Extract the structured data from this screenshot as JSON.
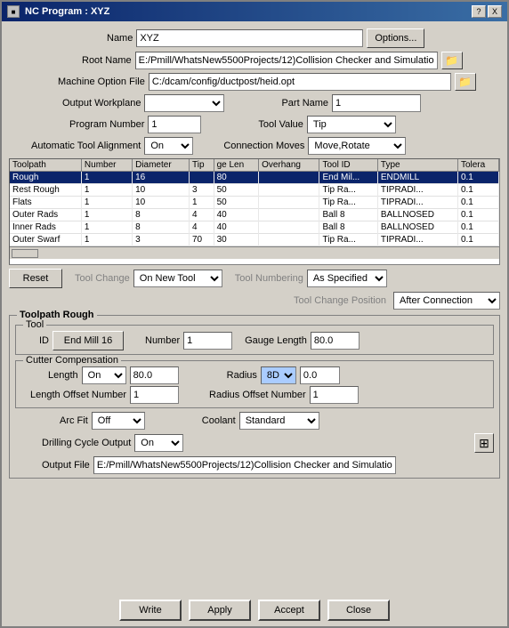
{
  "window": {
    "title": "NC Program : XYZ",
    "help_btn": "?",
    "close_btn": "X"
  },
  "form": {
    "name_label": "Name",
    "name_value": "XYZ",
    "options_btn": "Options...",
    "root_name_label": "Root Name",
    "root_name_value": "E:/Pmill/WhatsNew5500Projects/12)Collision Checker and Simulatio",
    "machine_option_label": "Machine Option File",
    "machine_option_value": "C:/dcam/config/ductpost/heid.opt",
    "output_workplane_label": "Output Workplane",
    "output_workplane_value": "",
    "part_name_label": "Part Name",
    "part_name_value": "1",
    "program_number_label": "Program Number",
    "program_number_value": "1",
    "tool_value_label": "Tool Value",
    "tool_value_value": "Tip",
    "auto_tool_align_label": "Automatic Tool Alignment",
    "auto_tool_align_value": "On",
    "connection_moves_label": "Connection Moves",
    "connection_moves_value": "Move,Rotate",
    "tool_change_label": "Tool Change",
    "tool_change_value": "On New Tool",
    "tool_numbering_label": "Tool Numbering",
    "tool_numbering_value": "As Specified",
    "tool_change_pos_label": "Tool Change Position",
    "tool_change_pos_value": "After Connection",
    "reset_btn": "Reset"
  },
  "table": {
    "columns": [
      "Toolpath",
      "Number",
      "Diameter",
      "Tip",
      "ge Len",
      "Overhang",
      "Tool ID",
      "Type",
      "Tolera"
    ],
    "rows": [
      [
        "Rough",
        "1",
        "16",
        "",
        "80",
        "",
        "End Mil...",
        "ENDMILL",
        "0.1"
      ],
      [
        "Rest Rough",
        "1",
        "10",
        "3",
        "50",
        "",
        "Tip Ra...",
        "TIPRADI...",
        "0.1"
      ],
      [
        "Flats",
        "1",
        "10",
        "1",
        "50",
        "",
        "Tip Ra...",
        "TIPRADI...",
        "0.1"
      ],
      [
        "Outer Rads",
        "1",
        "8",
        "4",
        "40",
        "",
        "Ball 8",
        "BALLNOSED",
        "0.1"
      ],
      [
        "Inner Rads",
        "1",
        "8",
        "4",
        "40",
        "",
        "Ball 8",
        "BALLNOSED",
        "0.1"
      ],
      [
        "Outer Swarf",
        "1",
        "3",
        "70",
        "30",
        "",
        "Tip Ra...",
        "TIPRADI...",
        "0.1"
      ]
    ],
    "selected_row": 0
  },
  "toolpath_section": {
    "label": "Toolpath Rough",
    "tool_label": "Tool",
    "id_label": "ID",
    "id_value": "End Mill 16",
    "number_label": "Number",
    "number_value": "1",
    "gauge_length_label": "Gauge Length",
    "gauge_length_value": "80.0",
    "cutter_comp_label": "Cutter Compensation",
    "length_label": "Length",
    "length_value": "On",
    "length_num_label": "80.0",
    "radius_label": "Radius",
    "radius_value": "8D",
    "radius_num_value": "0.0",
    "length_offset_label": "Length Offset Number",
    "length_offset_value": "1",
    "radius_offset_label": "Radius Offset Number",
    "radius_offset_value": "1",
    "arc_fit_label": "Arc Fit",
    "arc_fit_value": "Off",
    "coolant_label": "Coolant",
    "coolant_value": "Standard",
    "drilling_cycle_label": "Drilling Cycle Output",
    "drilling_cycle_value": "On",
    "output_file_label": "Output File",
    "output_file_value": "E:/Pmill/WhatsNew5500Projects/12)Collision Checker and Simulatio"
  },
  "buttons": {
    "write": "Write",
    "apply": "Apply",
    "accept": "Accept",
    "close": "Close"
  }
}
